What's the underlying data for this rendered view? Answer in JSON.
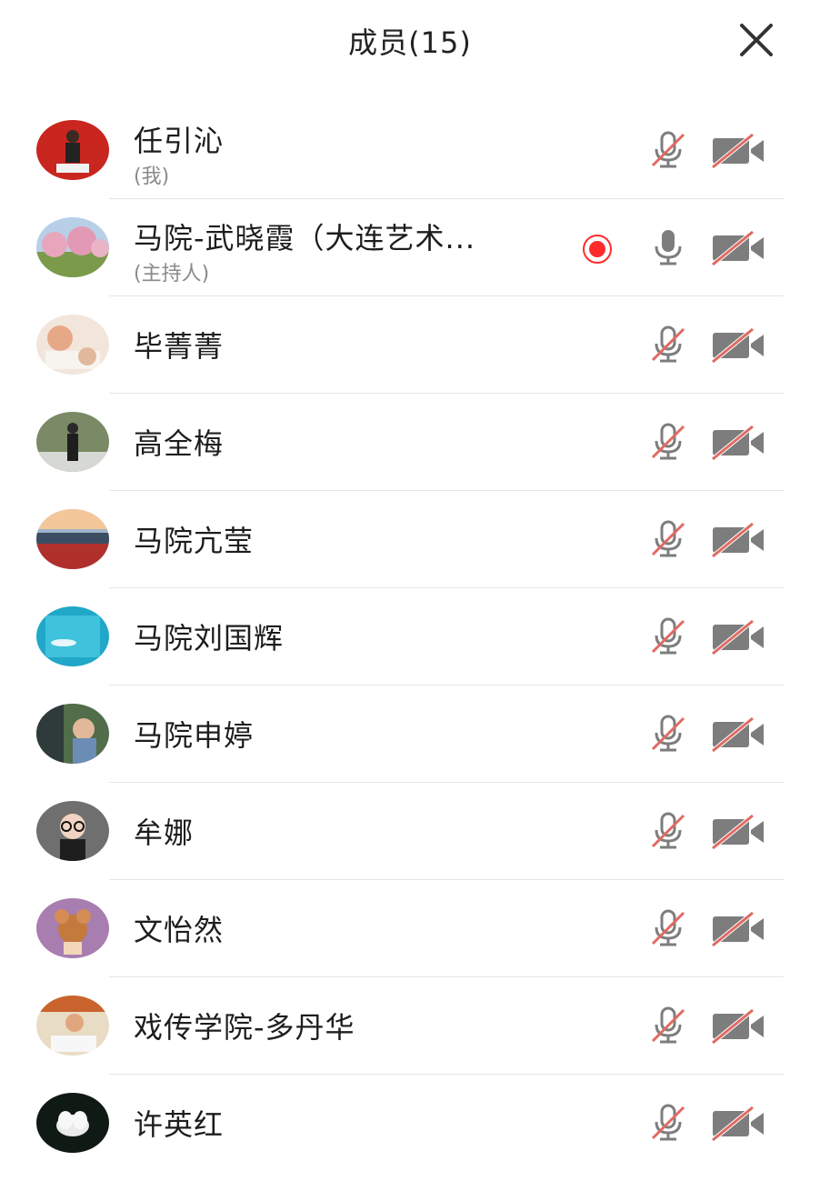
{
  "header": {
    "title": "成员(15)"
  },
  "colors": {
    "muted_slash": "#e06a63",
    "icon_gray": "#7d7d7d",
    "record_red": "#ff2b2b"
  },
  "members": [
    {
      "name": "任引沁",
      "sub": "(我)",
      "mic": "mic-muted-icon",
      "recording": false,
      "avatar": "a0"
    },
    {
      "name": "马院-武晓霞（大连艺术...",
      "sub": "(主持人)",
      "mic": "mic-on-icon",
      "recording": true,
      "avatar": "a1"
    },
    {
      "name": "毕菁菁",
      "sub": "",
      "mic": "mic-muted-icon",
      "recording": false,
      "avatar": "a2"
    },
    {
      "name": "高全梅",
      "sub": "",
      "mic": "mic-muted-icon",
      "recording": false,
      "avatar": "a3"
    },
    {
      "name": "马院亢莹",
      "sub": "",
      "mic": "mic-muted-icon",
      "recording": false,
      "avatar": "a4"
    },
    {
      "name": "马院刘国辉",
      "sub": "",
      "mic": "mic-muted-icon",
      "recording": false,
      "avatar": "a5"
    },
    {
      "name": "马院申婷",
      "sub": "",
      "mic": "mic-muted-icon",
      "recording": false,
      "avatar": "a6"
    },
    {
      "name": "牟娜",
      "sub": "",
      "mic": "mic-muted-icon",
      "recording": false,
      "avatar": "a7"
    },
    {
      "name": "文怡然",
      "sub": "",
      "mic": "mic-muted-icon",
      "recording": false,
      "avatar": "a8"
    },
    {
      "name": "戏传学院-多丹华",
      "sub": "",
      "mic": "mic-muted-icon",
      "recording": false,
      "avatar": "a9"
    },
    {
      "name": "许英红",
      "sub": "",
      "mic": "mic-muted-icon",
      "recording": false,
      "avatar": "a10"
    }
  ]
}
